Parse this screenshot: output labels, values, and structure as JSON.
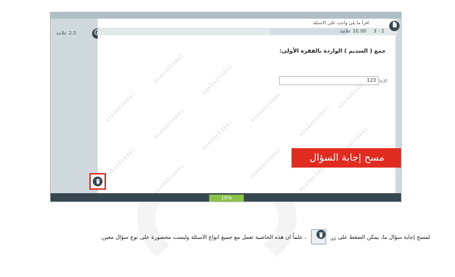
{
  "header": {
    "instruction": "اقرأ ما يلي واجب على الاسئلة",
    "section": "3 - 2",
    "section_grade": "10.00 علامة"
  },
  "left_rail": {
    "grade": "2.5 علامة"
  },
  "question": {
    "text": "جمع ( السديم ) الواردة بالفقرة الأولى:",
    "answer_label": "الإجابة:",
    "answer_value": "123"
  },
  "watermark": "A0A9AEEA8A1",
  "banner": "مسح إجابة السؤال",
  "progress": {
    "label": "10%",
    "value": 0.1
  },
  "caption": {
    "before": "لمسح إجابة سؤال ما، يمكن الضغط على زر",
    "after": "، علماً ان هذه الخاصية تعمل مع جميع انواع الاسئلة وليست محصورة على نوع سؤال معين."
  },
  "icons": {
    "info": "info-icon",
    "document": "document-icon",
    "trash": "trash-icon"
  },
  "colors": {
    "accent_red": "#e02b20",
    "dark": "#37474f",
    "progress_green": "#8bc34a"
  }
}
